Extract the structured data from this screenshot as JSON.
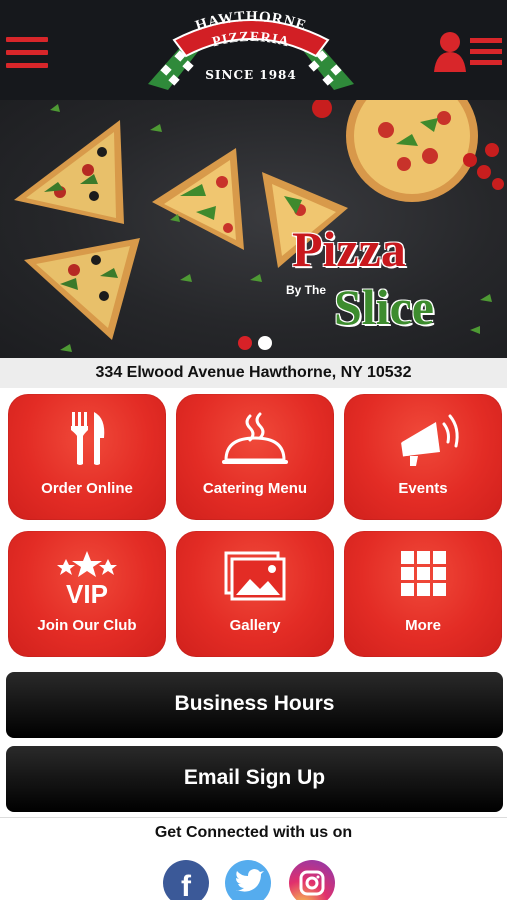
{
  "header": {
    "logo_name": "HAWTHORNE PIZZERIA",
    "logo_since": "SINCE 1984",
    "menu_icon": "hamburger-menu-icon",
    "profile_icon": "user-list-icon"
  },
  "banner": {
    "promo_top": "Pizza",
    "promo_small": "By The",
    "promo_bottom": "Slice",
    "slides_total": 2,
    "active_slide": 1
  },
  "address": "334 Elwood Avenue Hawthorne, NY 10532",
  "tiles": [
    {
      "label": "Order Online",
      "icon": "fork-knife-icon"
    },
    {
      "label": "Catering Menu",
      "icon": "cloche-icon"
    },
    {
      "label": "Events",
      "icon": "megaphone-icon"
    },
    {
      "label": "Join Our Club",
      "icon": "vip-stars-icon"
    },
    {
      "label": "Gallery",
      "icon": "gallery-icon"
    },
    {
      "label": "More",
      "icon": "grid-icon"
    }
  ],
  "buttons": {
    "business_hours": "Business Hours",
    "email_signup": "Email Sign Up"
  },
  "social": {
    "heading": "Get Connected with us on",
    "networks": [
      {
        "name": "facebook-icon",
        "color": "#3b5998"
      },
      {
        "name": "twitter-icon",
        "color": "#55acee"
      },
      {
        "name": "instagram-icon",
        "color": "#c13584"
      }
    ]
  },
  "colors": {
    "brand_red": "#e32c25",
    "header_bg": "#16181c",
    "promo_green": "#3d8c2e"
  }
}
